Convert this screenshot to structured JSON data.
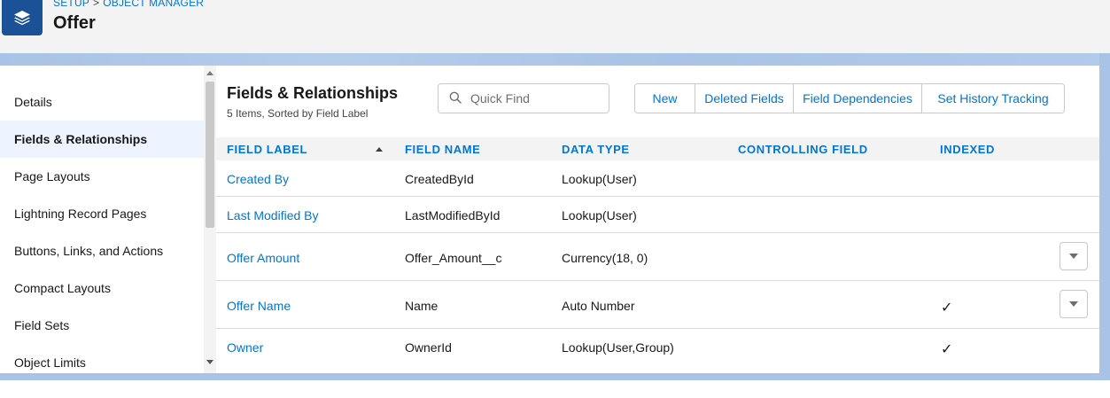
{
  "header": {
    "breadcrumb": [
      "SETUP",
      "OBJECT MANAGER"
    ],
    "breadcrumb_sep": ">",
    "title": "Offer",
    "icon": "layers-icon"
  },
  "sidebar": {
    "items": [
      {
        "label": "Details"
      },
      {
        "label": "Fields & Relationships"
      },
      {
        "label": "Page Layouts"
      },
      {
        "label": "Lightning Record Pages"
      },
      {
        "label": "Buttons, Links, and Actions"
      },
      {
        "label": "Compact Layouts"
      },
      {
        "label": "Field Sets"
      },
      {
        "label": "Object Limits"
      }
    ],
    "active_index": 1
  },
  "main": {
    "title": "Fields & Relationships",
    "subtitle": "5 Items, Sorted by Field Label",
    "search_placeholder": "Quick Find",
    "buttons": [
      "New",
      "Deleted Fields",
      "Field Dependencies",
      "Set History Tracking"
    ]
  },
  "table": {
    "columns": [
      "FIELD LABEL",
      "FIELD NAME",
      "DATA TYPE",
      "CONTROLLING FIELD",
      "INDEXED"
    ],
    "rows": [
      {
        "label": "Created By",
        "name": "CreatedById",
        "type": "Lookup(User)",
        "controlling": "",
        "indexed": false,
        "menu": false
      },
      {
        "label": "Last Modified By",
        "name": "LastModifiedById",
        "type": "Lookup(User)",
        "controlling": "",
        "indexed": false,
        "menu": false
      },
      {
        "label": "Offer Amount",
        "name": "Offer_Amount__c",
        "type": "Currency(18, 0)",
        "controlling": "",
        "indexed": false,
        "menu": true
      },
      {
        "label": "Offer Name",
        "name": "Name",
        "type": "Auto Number",
        "controlling": "",
        "indexed": true,
        "menu": true
      },
      {
        "label": "Owner",
        "name": "OwnerId",
        "type": "Lookup(User,Group)",
        "controlling": "",
        "indexed": true,
        "menu": false
      }
    ],
    "check_glyph": "✓"
  },
  "colors": {
    "brand": "#1b5297",
    "link": "#0176d3",
    "band": "#a9c3e6"
  }
}
